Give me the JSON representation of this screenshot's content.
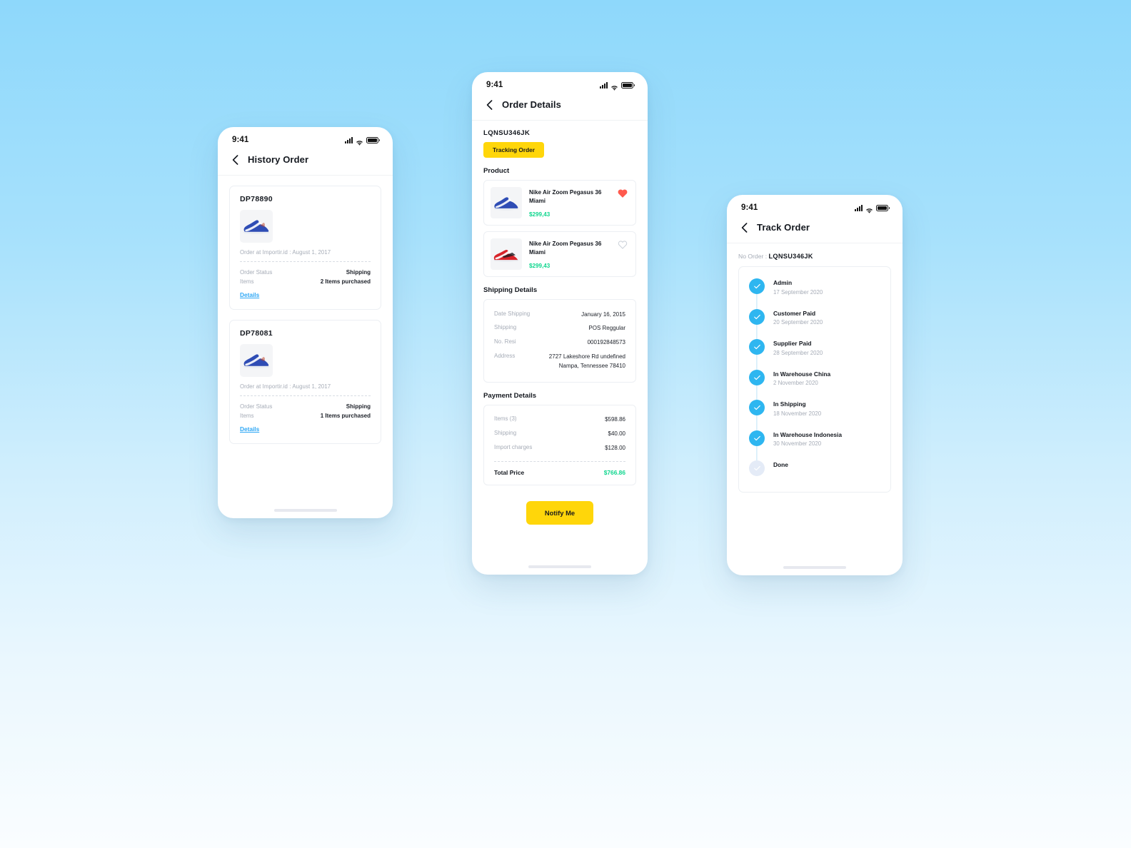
{
  "status_bar": {
    "time": "9:41"
  },
  "history_screen": {
    "title": "History Order",
    "orders": [
      {
        "id": "DP78890",
        "meta": "Order at Importir.id : August 1, 2017",
        "status_key": "Order Status",
        "status_val": "Shipping",
        "items_key": "Items",
        "items_val": "2 Items purchased",
        "details_label": "Details",
        "thumb": "blue-sneaker"
      },
      {
        "id": "DP78081",
        "meta": "Order at Importir.id : August 1, 2017",
        "status_key": "Order Status",
        "status_val": "Shipping",
        "items_key": "Items",
        "items_val": "1 Items purchased",
        "details_label": "Details",
        "thumb": "blue-sneaker"
      }
    ]
  },
  "order_details_screen": {
    "title": "Order Details",
    "order_code": "LQNSU346JK",
    "tracking_badge": "Tracking Order",
    "product_section_title": "Product",
    "products": [
      {
        "name": "Nike Air Zoom Pegasus 36 Miami",
        "price": "$299,43",
        "favorited": true,
        "thumb": "blue-sneaker"
      },
      {
        "name": "Nike Air Zoom Pegasus 36 Miami",
        "price": "$299,43",
        "favorited": false,
        "thumb": "red-sneaker"
      }
    ],
    "shipping_section_title": "Shipping Details",
    "shipping_rows": [
      {
        "key": "Date Shipping",
        "value": "January 16, 2015"
      },
      {
        "key": "Shipping",
        "value": "POS Reggular"
      },
      {
        "key": "No. Resi",
        "value": "000192848573"
      },
      {
        "key": "Address",
        "value": "2727 Lakeshore Rd undefined Nampa, Tennessee 78410"
      }
    ],
    "payment_section_title": "Payment Details",
    "payment_rows": [
      {
        "key": "Items (3)",
        "value": "$598.86"
      },
      {
        "key": "Shipping",
        "value": "$40.00"
      },
      {
        "key": "Import charges",
        "value": "$128.00"
      }
    ],
    "total_key": "Total Price",
    "total_value": "$766.86",
    "notify_button": "Notify Me"
  },
  "track_screen": {
    "title": "Track Order",
    "no_order_label": "No Order :",
    "no_order_value": "LQNSU346JK",
    "steps": [
      {
        "label": "Admin",
        "date": "17 September 2020",
        "done": true
      },
      {
        "label": "Customer Paid",
        "date": "20 September 2020",
        "done": true
      },
      {
        "label": "Supplier Paid",
        "date": "28 September 2020",
        "done": true
      },
      {
        "label": "In Warehouse China",
        "date": "2 November 2020",
        "done": true
      },
      {
        "label": "In Shipping",
        "date": "18 November 2020",
        "done": true
      },
      {
        "label": "In Warehouse Indonesia",
        "date": "30 November 2020",
        "done": true
      },
      {
        "label": "Done",
        "date": "",
        "done": false
      }
    ]
  },
  "colors": {
    "accent_yellow": "#FFD60A",
    "accent_blue": "#2EB6F0",
    "link_blue": "#2EA7F5",
    "price_green": "#0FD68E",
    "heart_red": "#FF5A4E",
    "background_top": "#8ED8FB",
    "background_bottom": "#FAFDFF"
  }
}
